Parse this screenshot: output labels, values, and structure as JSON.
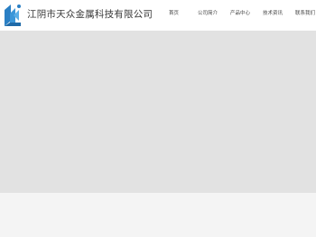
{
  "header": {
    "site_title": "江阴市天众金属科技有限公司",
    "logo_icon": "company-logo-icon",
    "brand_color": "#2a7fc4"
  },
  "nav": {
    "items": [
      {
        "label": "首页"
      },
      {
        "label": "公司简介"
      },
      {
        "label": "产品中心"
      },
      {
        "label": "技术资讯"
      },
      {
        "label": "联系我们"
      }
    ]
  },
  "hero": {
    "background": "#e2e2e2"
  }
}
